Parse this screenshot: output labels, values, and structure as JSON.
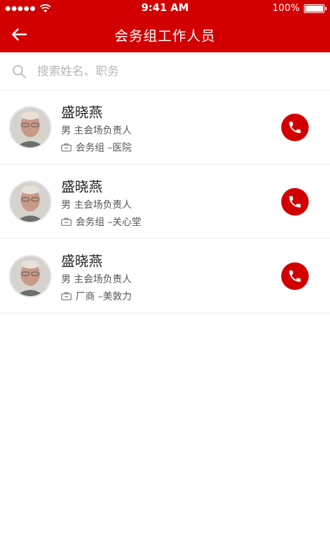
{
  "status_bar": {
    "time": "9:41 AM",
    "battery_text": "100%",
    "battery_level": 1.0
  },
  "nav": {
    "title": "会务组工作人员",
    "back_icon": "arrow-left-icon"
  },
  "search": {
    "placeholder": "搜索姓名、职务",
    "value": ""
  },
  "colors": {
    "brand": "#d20000",
    "text_primary": "#222222",
    "text_secondary": "#555555"
  },
  "staff": [
    {
      "name": "盛晓燕",
      "role": "男 主会场负责人",
      "org": "会务组 –医院"
    },
    {
      "name": "盛晓燕",
      "role": "男 主会场负责人",
      "org": "会务组 –关心堂"
    },
    {
      "name": "盛晓燕",
      "role": "男 主会场负责人",
      "org": "厂商 –美敦力"
    }
  ]
}
